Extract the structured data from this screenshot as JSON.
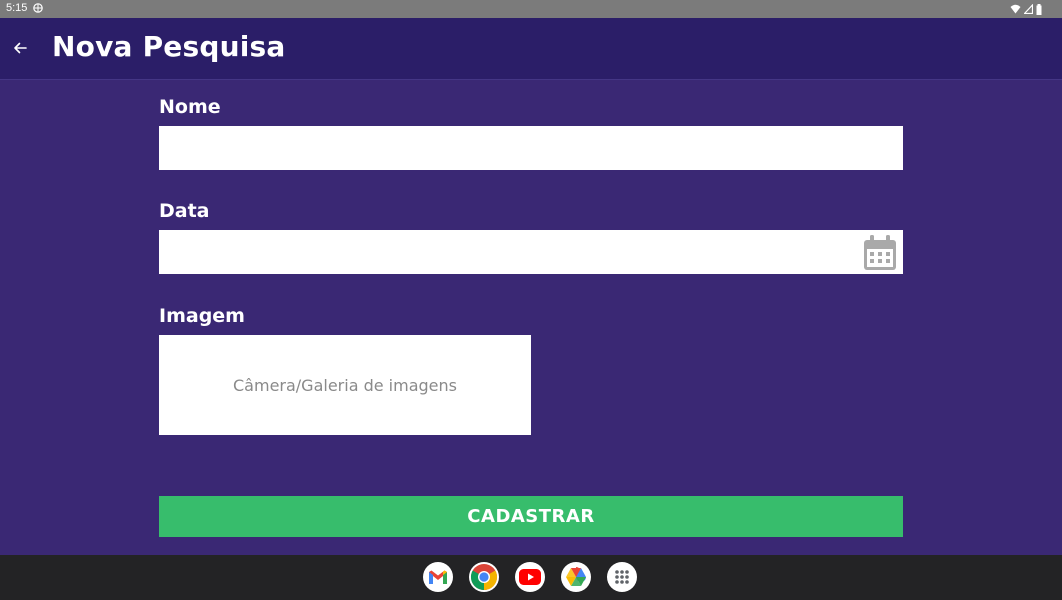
{
  "status_bar": {
    "time": "5:15",
    "icons": [
      "vpn-icon",
      "wifi-icon",
      "signal-icon",
      "battery-icon"
    ]
  },
  "app_bar": {
    "title": "Nova Pesquisa",
    "back_icon": "arrow-back-icon"
  },
  "form": {
    "name": {
      "label": "Nome",
      "value": "",
      "placeholder": ""
    },
    "date": {
      "label": "Data",
      "value": "",
      "placeholder": "",
      "icon": "calendar-icon"
    },
    "image": {
      "label": "Imagem",
      "picker_text": "Câmera/Galeria de imagens"
    },
    "submit_label": "CADASTRAR"
  },
  "dock": {
    "apps": [
      "gmail-icon",
      "chrome-icon",
      "youtube-icon",
      "photos-icon",
      "app-drawer-icon"
    ]
  },
  "colors": {
    "background": "#3a2874",
    "app_bar": "#2b1e68",
    "status_bar": "#7b7b7b",
    "submit_button": "#37bd6c",
    "dock": "#232325"
  }
}
